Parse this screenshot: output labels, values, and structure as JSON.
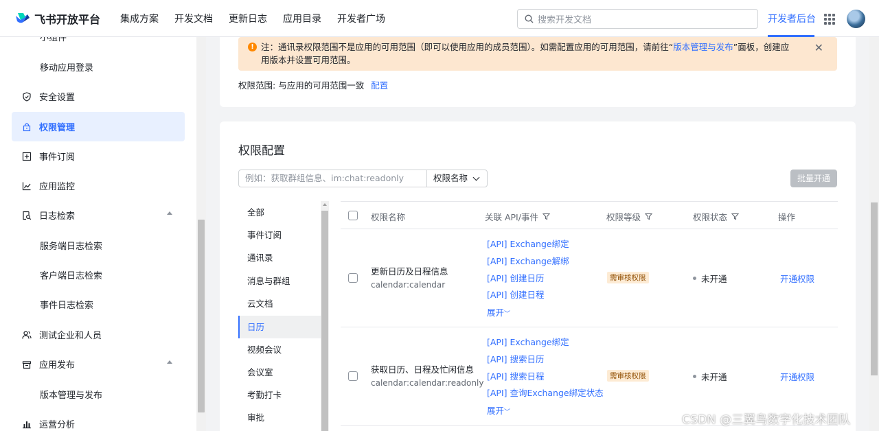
{
  "header": {
    "brand": "飞书开放平台",
    "nav": [
      "集成方案",
      "开发文档",
      "更新日志",
      "应用目录",
      "开发者广场"
    ],
    "search_placeholder": "搜索开发文档",
    "dev_console": "开发者后台"
  },
  "sidebar": {
    "items": [
      {
        "label": "小组件",
        "sub": true
      },
      {
        "label": "移动应用登录",
        "sub": true
      },
      {
        "label": "安全设置",
        "icon": "shield-icon"
      },
      {
        "label": "权限管理",
        "icon": "lock-icon",
        "active": true
      },
      {
        "label": "事件订阅",
        "icon": "plus-square-icon"
      },
      {
        "label": "应用监控",
        "icon": "line-chart-icon"
      },
      {
        "label": "日志检索",
        "icon": "log-search-icon",
        "expandable": true
      },
      {
        "label": "服务端日志检索",
        "sub": true
      },
      {
        "label": "客户端日志检索",
        "sub": true
      },
      {
        "label": "事件日志检索",
        "sub": true
      },
      {
        "label": "测试企业和人员",
        "icon": "users-icon"
      },
      {
        "label": "应用发布",
        "icon": "store-icon",
        "expandable": true
      },
      {
        "label": "版本管理与发布",
        "sub": true
      },
      {
        "label": "运营分析",
        "icon": "bar-chart-icon"
      }
    ]
  },
  "notice": {
    "prefix": "注：通讯录权限范围不是应用的可用范围（即可以使用应用的成员范围）。如需配置应用的可用范围，请前往“",
    "link": "版本管理与发布",
    "suffix": "”面板，创建应用版本并设置可用范围。"
  },
  "scope": {
    "label": "权限范围:",
    "value": "与应用的可用范围一致",
    "link": "配置"
  },
  "permissions": {
    "title": "权限配置",
    "search_placeholder": "例如：获取群组信息、im:chat:readonly",
    "select_value": "权限名称",
    "bulk_button": "批量开通",
    "categories": [
      "全部",
      "事件订阅",
      "通讯录",
      "消息与群组",
      "云文档",
      "日历",
      "视频会议",
      "会议室",
      "考勤打卡",
      "审批"
    ],
    "active_category": "日历",
    "columns": [
      "权限名称",
      "关联 API/事件",
      "权限等级",
      "权限状态",
      "操作"
    ],
    "rows": [
      {
        "name": "更新日历及日程信息",
        "key": "calendar:calendar",
        "apis": [
          "[API] Exchange绑定",
          "[API] Exchange解绑",
          "[API] 创建日历",
          "[API] 创建日程"
        ],
        "expand": "展开",
        "level": "需审核权限",
        "status": "未开通",
        "action": "开通权限"
      },
      {
        "name": "获取日历、日程及忙闲信息",
        "key": "calendar:calendar:readonly",
        "apis": [
          "[API] Exchange绑定",
          "[API] 搜索日历",
          "[API] 搜索日程",
          "[API] 查询Exchange绑定状态"
        ],
        "expand": "展开",
        "level": "需审核权限",
        "status": "未开通",
        "action": "开通权限"
      }
    ]
  },
  "watermark": "CSDN @三翼鸟数字化技术团队",
  "colors": {
    "accent": "#3370ff",
    "notice_bg": "#fde7d0",
    "warn": "#ff8800",
    "badge_bg": "#fdebd4"
  }
}
